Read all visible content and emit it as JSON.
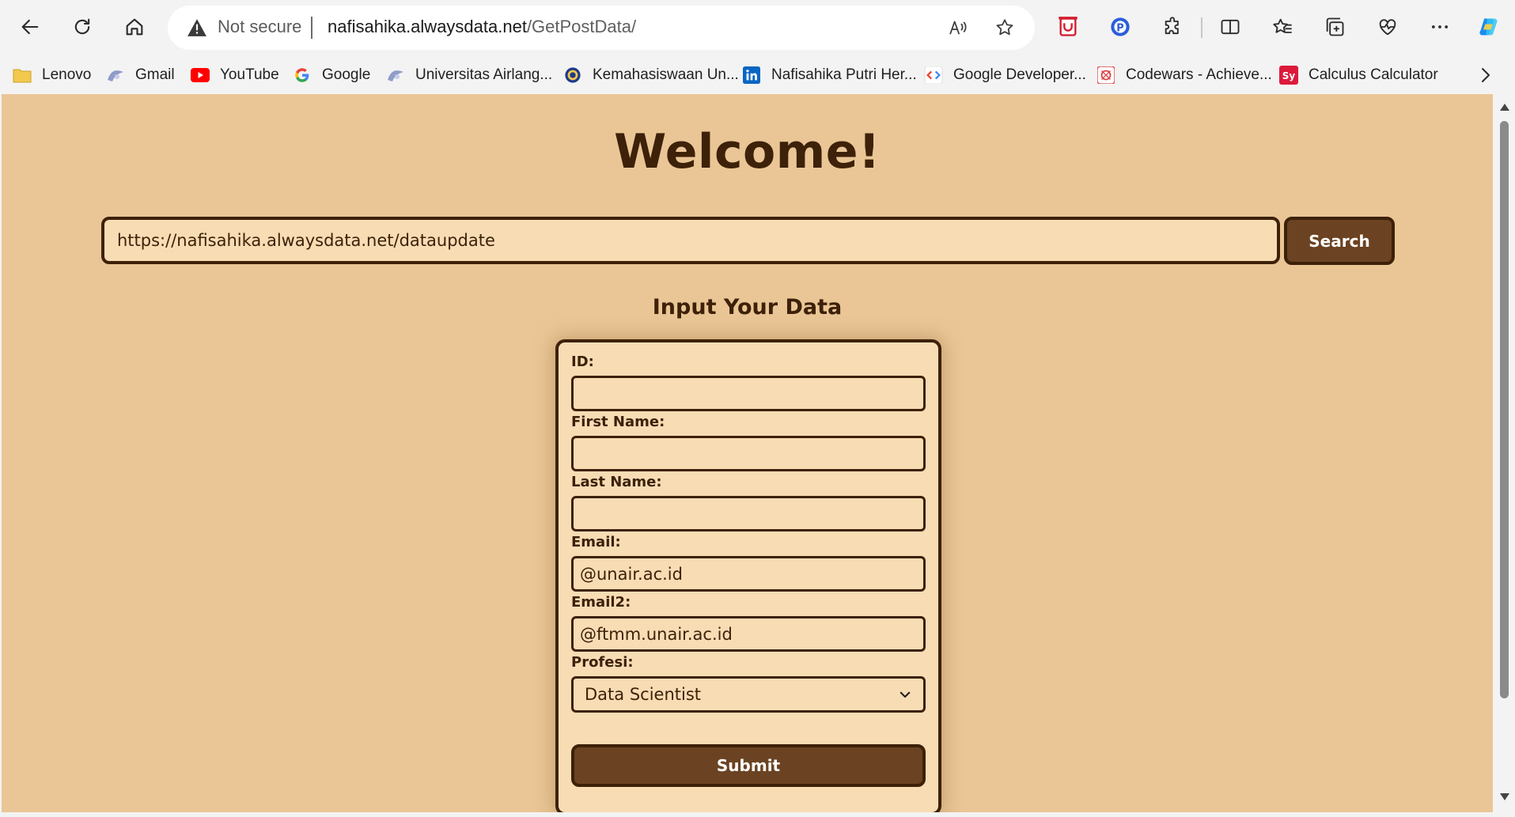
{
  "browser": {
    "security_label": "Not secure",
    "url_host": "nafisahika.alwaysdata.net",
    "url_path": "/GetPostData/",
    "bookmarks": [
      {
        "label": "Lenovo",
        "icon": "folder-icon"
      },
      {
        "label": "Gmail",
        "icon": "unair-logo-icon"
      },
      {
        "label": "YouTube",
        "icon": "youtube-icon"
      },
      {
        "label": "Google",
        "icon": "google-icon"
      },
      {
        "label": "Universitas Airlang...",
        "icon": "unair-logo-icon"
      },
      {
        "label": "Kemahasiswaan Un...",
        "icon": "kemahasiswaan-icon"
      },
      {
        "label": "Nafisahika Putri Her...",
        "icon": "linkedin-icon"
      },
      {
        "label": "Google Developer...",
        "icon": "google-developers-icon"
      },
      {
        "label": "Codewars - Achieve...",
        "icon": "codewars-icon"
      },
      {
        "label": "Calculus Calculator",
        "icon": "symbolab-icon"
      }
    ]
  },
  "page": {
    "title": "Welcome!",
    "search": {
      "value": "https://nafisahika.alwaysdata.net/dataupdate",
      "button_label": "Search"
    },
    "form": {
      "heading": "Input Your Data",
      "fields": {
        "id_label": "ID:",
        "id_value": "",
        "first_name_label": "First Name:",
        "first_name_value": "",
        "last_name_label": "Last Name:",
        "last_name_value": "",
        "email_label": "Email:",
        "email_value": "@unair.ac.id",
        "email2_label": "Email2:",
        "email2_value": "@ftmm.unair.ac.id",
        "profesi_label": "Profesi:",
        "profesi_selected": "Data Scientist"
      },
      "submit_label": "Submit"
    }
  },
  "colors": {
    "page_bg": "#eac696",
    "field_bg": "#f8dcb4",
    "border_dark": "#3d2109",
    "button_bg": "#6b4322"
  }
}
